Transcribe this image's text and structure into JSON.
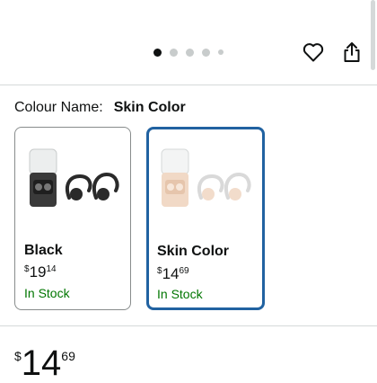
{
  "carousel": {
    "dot_count": 5,
    "active_index": 0
  },
  "colour": {
    "label": "Colour Name:",
    "selected": "Skin Color"
  },
  "options": [
    {
      "name": "Black",
      "currency": "$",
      "price_whole": "19",
      "price_fraction": "14",
      "stock": "In Stock",
      "selected": false
    },
    {
      "name": "Skin Color",
      "currency": "$",
      "price_whole": "14",
      "price_fraction": "69",
      "stock": "In Stock",
      "selected": true
    }
  ],
  "price": {
    "currency": "$",
    "whole": "14",
    "fraction": "69"
  },
  "icons": {
    "favorite": "heart-icon",
    "share": "share-icon"
  },
  "colors": {
    "selected_border": "#2162a1",
    "in_stock": "#007600"
  }
}
